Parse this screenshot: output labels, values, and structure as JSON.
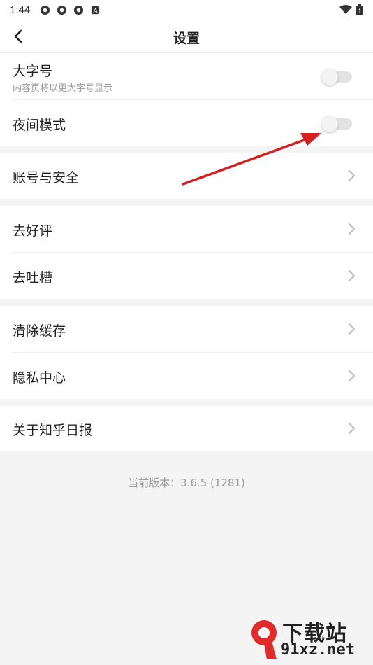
{
  "status_bar": {
    "time": "1:44",
    "icons": [
      "settings-icon",
      "settings-icon",
      "settings-icon",
      "a-icon"
    ],
    "right_icons": [
      "wifi-icon",
      "battery-icon"
    ]
  },
  "app_bar": {
    "title": "设置",
    "back_icon": "back-arrow-icon"
  },
  "settings": {
    "large_font": {
      "label": "大字号",
      "sub": "内容页将以更大字号显示",
      "enabled": false
    },
    "night_mode": {
      "label": "夜间模式",
      "enabled": false
    },
    "account": {
      "label": "账号与安全"
    },
    "rate": {
      "label": "去好评"
    },
    "feedback": {
      "label": "去吐槽"
    },
    "clear_cache": {
      "label": "清除缓存"
    },
    "privacy": {
      "label": "隐私中心"
    },
    "about": {
      "label": "关于知乎日报"
    }
  },
  "version_text": "当前版本：3.6.5 (1281)",
  "watermark": {
    "text": "下载站",
    "url": "91xz.net",
    "logo": "91"
  },
  "colors": {
    "background": "#f4f4f4",
    "surface": "#ffffff",
    "annotation_arrow": "#d42020",
    "watermark_red": "#e02b2b"
  }
}
